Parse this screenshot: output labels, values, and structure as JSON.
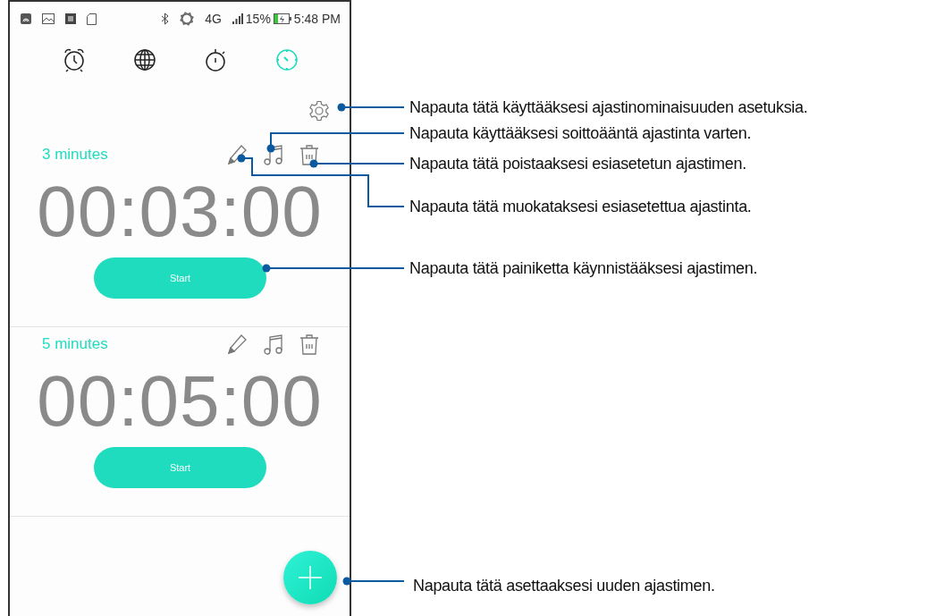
{
  "status_bar": {
    "network": "4G",
    "battery": "15%",
    "time": "5:48 PM"
  },
  "tabs": [
    {
      "kind": "alarm",
      "selected": false
    },
    {
      "kind": "world",
      "selected": false
    },
    {
      "kind": "stopwatch",
      "selected": false
    },
    {
      "kind": "timer",
      "selected": true
    }
  ],
  "timers": [
    {
      "name": "3 minutes",
      "time": "00:03:00",
      "button": "Start"
    },
    {
      "name": "5 minutes",
      "time": "00:05:00",
      "button": "Start"
    }
  ],
  "callouts": [
    {
      "text": "Napauta tätä käyttääksesi ajastinominaisuuden asetuksia."
    },
    {
      "text": "Napauta käyttääksesi soittoääntä ajastinta varten."
    },
    {
      "text": "Napauta tätä poistaaksesi esiasetetun ajastimen."
    },
    {
      "text": "Napauta tätä muokataksesi esiasetettua ajastinta."
    },
    {
      "text": "Napauta tätä painiketta käynnistääksesi ajastimen."
    },
    {
      "text": "Napauta tätä asettaaksesi uuden ajastimen."
    }
  ]
}
